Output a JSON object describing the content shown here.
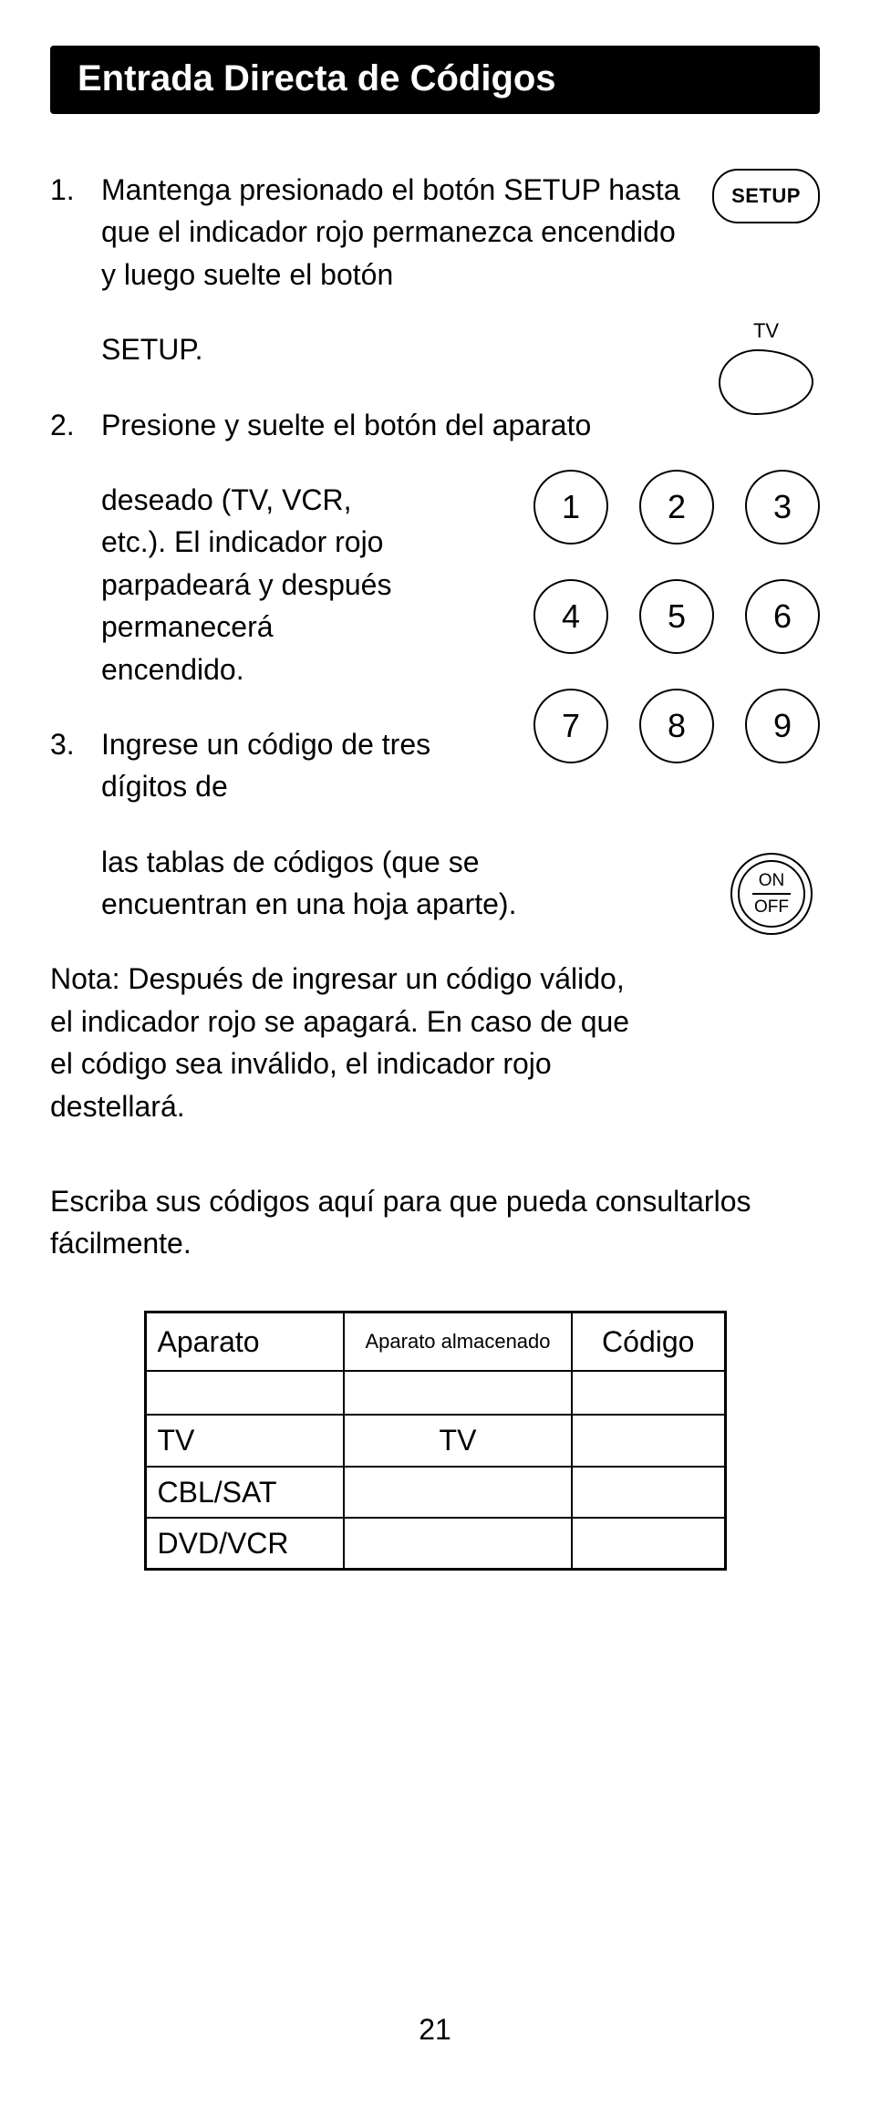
{
  "title": "Entrada Directa de Códigos",
  "steps": {
    "s1_num": "1.",
    "s1_a": "Mantenga presionado el botón SETUP hasta que el indicador rojo permanezca encendido y luego suelte el botón",
    "s1_b": "SETUP.",
    "s2_num": "2.",
    "s2_a": "Presione y suelte el botón del aparato",
    "s2_b": "deseado (TV, VCR, etc.). El indicador rojo parpadeará y después permanecerá encendido.",
    "s3_num": "3.",
    "s3_a": "Ingrese un código de tres dígitos de",
    "s3_b": "las tablas de códigos (que se encuentran en una hoja aparte).",
    "note": "Nota: Después de ingresar un código válido, el indicador rojo se apagará. En caso de que el código sea inválido, el indicador rojo destellará."
  },
  "icons": {
    "setup": "SETUP",
    "tv": "TV",
    "on": "ON",
    "off": "OFF"
  },
  "keys": [
    "1",
    "2",
    "3",
    "4",
    "5",
    "6",
    "7",
    "8",
    "9"
  ],
  "write_note": "Escriba sus códigos aquí para que pueda consultarlos fácilmente.",
  "table": {
    "headers": {
      "a": "Aparato",
      "b": "Aparato almacenado",
      "c": "Código"
    },
    "rows": [
      {
        "a": "",
        "b": "",
        "c": ""
      },
      {
        "a": "TV",
        "b": "TV",
        "c": ""
      },
      {
        "a": "CBL/SAT",
        "b": "",
        "c": ""
      },
      {
        "a": "DVD/VCR",
        "b": "",
        "c": ""
      }
    ]
  },
  "page_number": "21"
}
